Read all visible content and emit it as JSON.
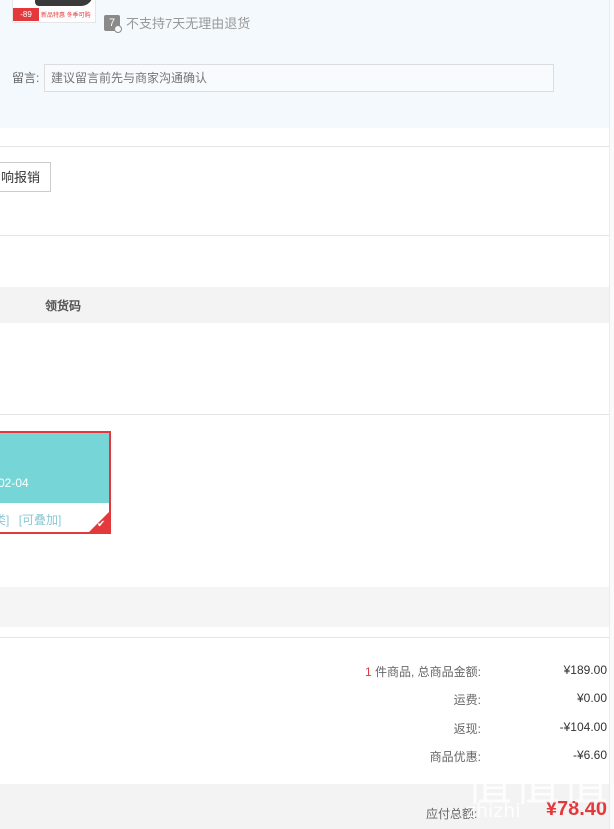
{
  "product": {
    "promo_price": "-89",
    "promo_text": "新品特惠 冬季可购",
    "return_policy_icon": "7",
    "return_policy_text": "不支持7天无理由退货"
  },
  "message": {
    "label": "留言:",
    "placeholder": "建议留言前先与商家沟通确认"
  },
  "expense": {
    "button_label": "响报销"
  },
  "pickup": {
    "column_label": "领货码"
  },
  "coupon": {
    "date_text": "-02-04",
    "tag_1": "类]",
    "tag_2": "[可叠加]",
    "selected": true
  },
  "summary": {
    "item_count": "1",
    "items_label": " 件商品, 总商品金额:",
    "items_total": "¥189.00",
    "shipping_label": "运费:",
    "shipping_value": "¥0.00",
    "rebate_label": "返现:",
    "rebate_value": "-¥104.00",
    "discount_label": "商品优惠:",
    "discount_value": "-¥6.60",
    "total_label": "应付总额:",
    "total_value": "¥78.40"
  },
  "watermark": {
    "glyphs": "值值值",
    "domain": "zhizhi"
  },
  "colors": {
    "accent_red": "#e4393c",
    "coupon_teal": "#76d5d6",
    "panel_bg": "#f3f9fd"
  },
  "icons": [
    "return-policy-7-icon",
    "checkmark-icon"
  ]
}
